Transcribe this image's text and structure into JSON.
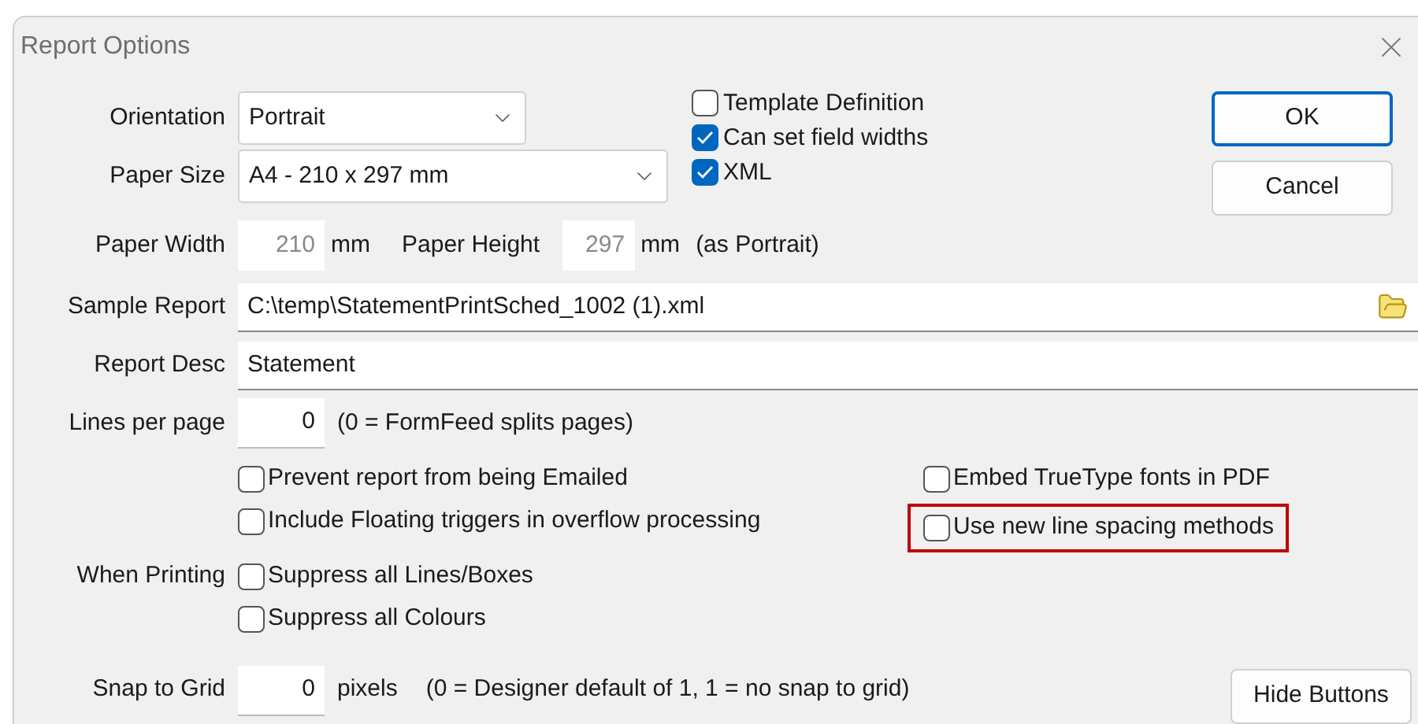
{
  "window": {
    "title": "Report Options"
  },
  "orientation": {
    "label": "Orientation",
    "value": "Portrait"
  },
  "paper_size": {
    "label": "Paper Size",
    "value": "A4 - 210 x 297 mm"
  },
  "paper_width": {
    "label": "Paper Width",
    "value": "210",
    "unit": "mm",
    "disabled": true
  },
  "paper_height": {
    "label": "Paper Height",
    "value": "297",
    "unit": "mm",
    "note": "(as Portrait)",
    "disabled": true
  },
  "format_options": [
    {
      "label": "Template Definition",
      "checked": false
    },
    {
      "label": "Can set field widths",
      "checked": true
    },
    {
      "label": "XML",
      "checked": true
    }
  ],
  "buttons": [
    {
      "label": "OK",
      "default": true
    },
    {
      "label": "Cancel",
      "default": false
    }
  ],
  "sample_report": {
    "label": "Sample Report",
    "value": "C:\\temp\\StatementPrintSched_1002 (1).xml"
  },
  "report_desc": {
    "label": "Report Desc",
    "value": "Statement"
  },
  "lines_per_page": {
    "label": "Lines per page",
    "value": "0",
    "note": "(0 = FormFeed splits pages)"
  },
  "left_options": [
    {
      "label": "Prevent report from being Emailed",
      "checked": false
    },
    {
      "label": "Include Floating triggers in overflow processing",
      "checked": false
    }
  ],
  "right_options": [
    {
      "label": "Embed TrueType fonts in PDF",
      "checked": false,
      "highlighted": false
    },
    {
      "label": "Use new line spacing methods",
      "checked": false,
      "highlighted": true
    }
  ],
  "when_printing": {
    "label": "When Printing",
    "options": [
      {
        "label": "Suppress all Lines/Boxes",
        "checked": false
      },
      {
        "label": "Suppress all Colours",
        "checked": false
      }
    ]
  },
  "snap_to_grid": {
    "label": "Snap to Grid",
    "value": "0",
    "unit": "pixels",
    "note": "(0 = Designer default of 1, 1 = no snap to grid)"
  },
  "hide_button": {
    "label": "Hide Buttons"
  }
}
